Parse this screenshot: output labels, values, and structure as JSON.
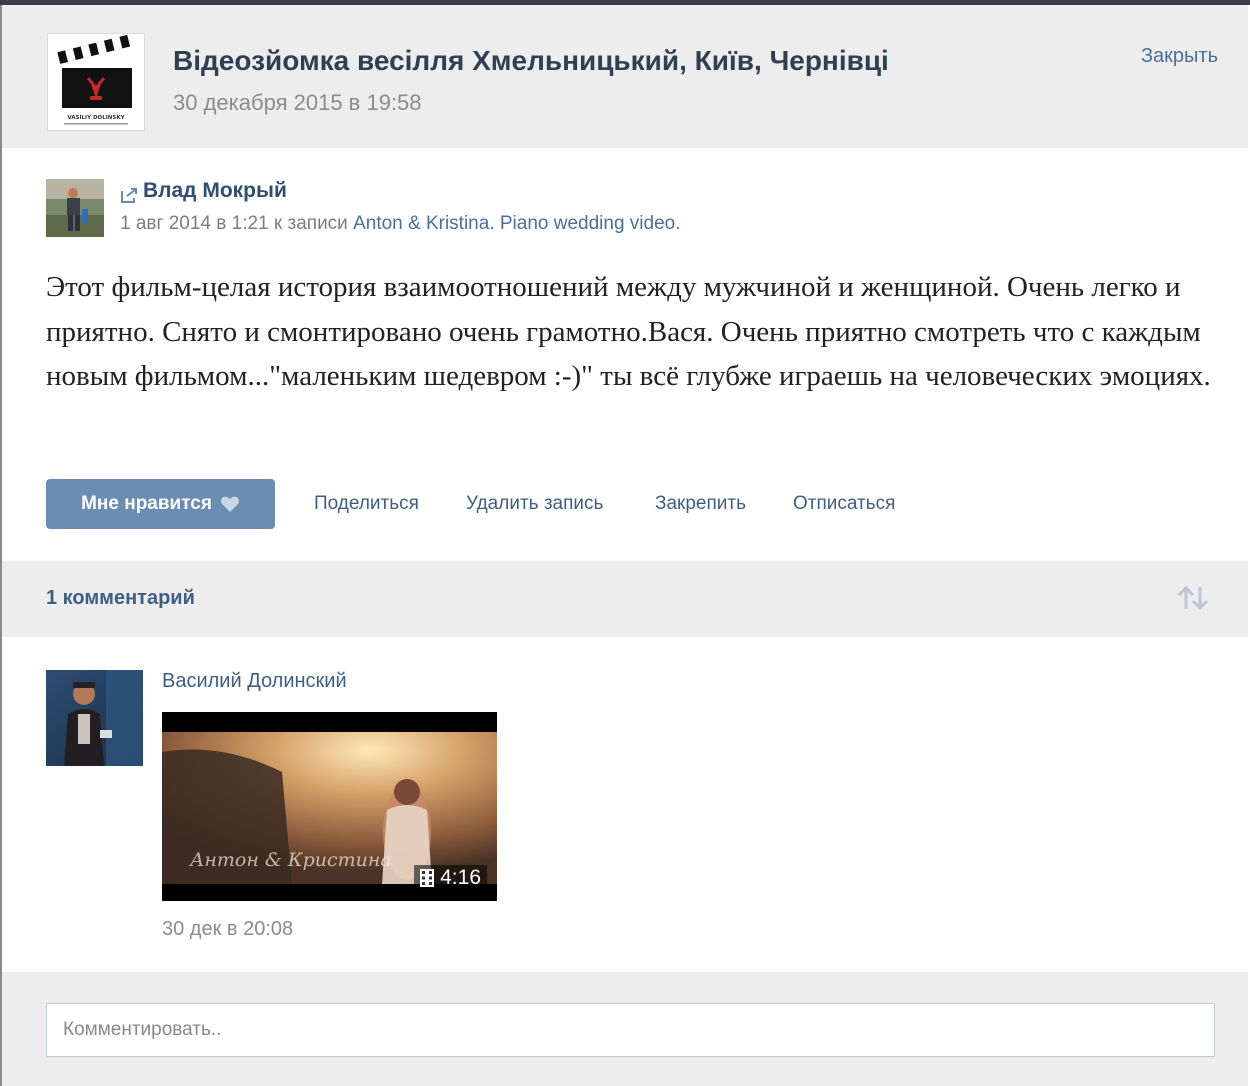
{
  "header": {
    "title": "Відеозйомка весілля Хмельницький, Київ, Чернівці",
    "date": "30 декабря 2015 в 19:58",
    "close_label": "Закрыть",
    "logo_text": "VASILIY DOLINSKY"
  },
  "post": {
    "author": "Влад Мокрый",
    "repost_date": "1 авг 2014 в 1:21",
    "repost_prefix": "к записи",
    "repost_source": "Anton & Kristina. Piano wedding video.",
    "text": "Этот фильм-целая история взаимоотношений между мужчиной и женщиной. Очень легко и приятно. Снято и смонтировано очень грамотно.Вася. Очень приятно смотреть что с каждым новым фильмом...\"маленьким шедевром :-)\" ты всё глубже играешь на человеческих эмоциях.",
    "actions": {
      "like": "Мне нравится",
      "share": "Поделиться",
      "delete": "Удалить запись",
      "pin": "Закрепить",
      "unsubscribe": "Отписаться"
    }
  },
  "comments": {
    "count_label": "1 комментарий",
    "items": [
      {
        "author": "Василий Долинский",
        "video_duration": "4:16",
        "video_overlay_text": "Антон & Кристина",
        "date": "30 дек в 20:08"
      }
    ]
  },
  "reply": {
    "placeholder": "Комментировать.."
  },
  "colors": {
    "link": "#3e5f85",
    "like_button": "#6b8db3",
    "header_bg": "#ededed",
    "muted": "#8c8c8c"
  }
}
